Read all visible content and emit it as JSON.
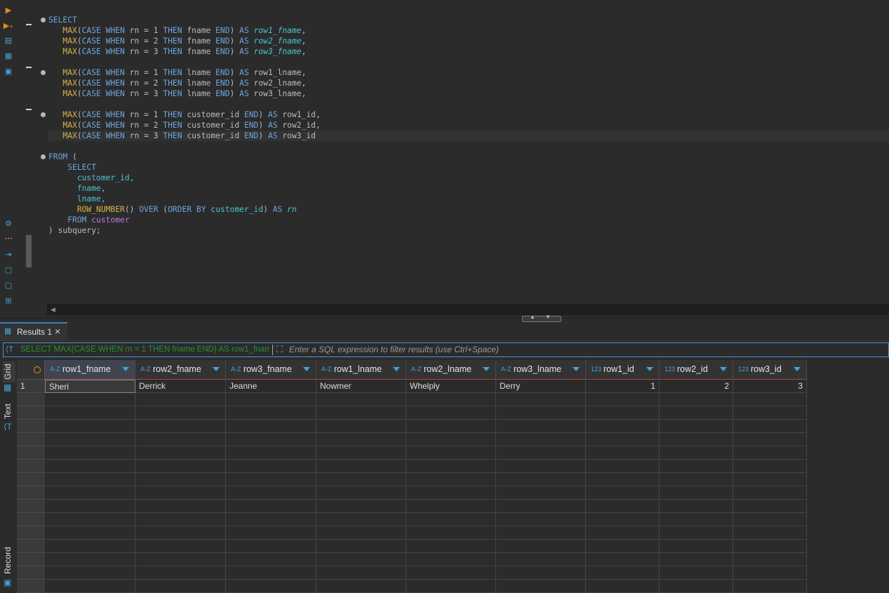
{
  "editor": {
    "gutter_icons": [
      "execute-icon",
      "execute-new-tab-icon",
      "execute-script-icon",
      "script-icon",
      "explain-icon"
    ],
    "tool_icons": [
      "gear-icon",
      "more-icon",
      "export-icon",
      "error-icon",
      "transaction-icon",
      "outline-icon"
    ],
    "sql": {
      "select": "SELECT",
      "from": "FROM",
      "open_paren": "(",
      "inner_select": "SELECT",
      "customer_id": "customer_id,",
      "fname": "fname,",
      "lname": "lname,",
      "inner_from": "FROM",
      "table": "customer",
      "close": ") subquery;"
    }
  },
  "results": {
    "tab_label": "Results 1",
    "filter_query": "SELECT MAX(CASE WHEN rn = 1 THEN fname END) AS row1_fnam",
    "filter_placeholder": "Enter a SQL expression to filter results (use Ctrl+Space)",
    "side_tabs": [
      "Grid",
      "Text",
      "Record"
    ],
    "columns": [
      {
        "type": "A-Z",
        "label": "row1_fname"
      },
      {
        "type": "A-Z",
        "label": "row2_fname"
      },
      {
        "type": "A-Z",
        "label": "row3_fname"
      },
      {
        "type": "A-Z",
        "label": "row1_lname"
      },
      {
        "type": "A-Z",
        "label": "row2_lname"
      },
      {
        "type": "A-Z",
        "label": "row3_lname"
      },
      {
        "type": "123",
        "label": "row1_id"
      },
      {
        "type": "123",
        "label": "row2_id"
      },
      {
        "type": "123",
        "label": "row3_id"
      }
    ],
    "rows": [
      {
        "num": "1",
        "cells": [
          "Sheri",
          "Derrick",
          "Jeanne",
          "Nowmer",
          "Whelply",
          "Derry",
          "1",
          "2",
          "3"
        ]
      }
    ]
  }
}
